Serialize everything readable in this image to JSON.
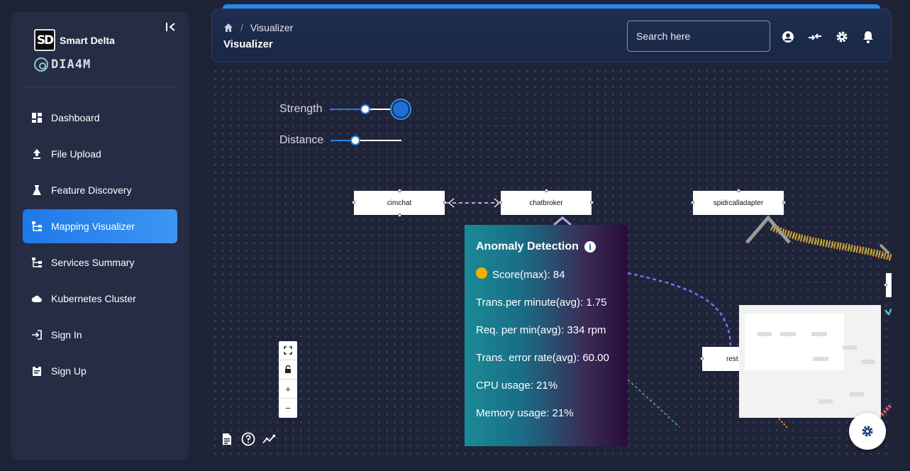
{
  "brand": {
    "logo_text": "SD",
    "name": "Smart Delta",
    "product": "DIA4M"
  },
  "sidebar": {
    "items": [
      {
        "label": "Dashboard",
        "icon": "dashboard-icon"
      },
      {
        "label": "File Upload",
        "icon": "upload-icon"
      },
      {
        "label": "Feature Discovery",
        "icon": "flask-icon"
      },
      {
        "label": "Mapping Visualizer",
        "icon": "tree-icon",
        "active": true
      },
      {
        "label": "Services Summary",
        "icon": "tree-icon"
      },
      {
        "label": "Kubernetes Cluster",
        "icon": "cloud-icon"
      },
      {
        "label": "Sign In",
        "icon": "login-icon"
      },
      {
        "label": "Sign Up",
        "icon": "assignment-icon"
      }
    ]
  },
  "header": {
    "breadcrumb": {
      "current": "Visualizer",
      "separator": "/"
    },
    "title": "Visualizer",
    "search_placeholder": "Search here"
  },
  "controls": {
    "strength_label": "Strength",
    "distance_label": "Distance",
    "strength_value": 0.5,
    "distance_value": 0.35
  },
  "graph": {
    "nodes": [
      "cimchat",
      "chatbroker",
      "spidrcalladapter",
      "rest"
    ]
  },
  "tooltip": {
    "title": "Anomaly Detection",
    "score": "Score(max): 84",
    "trans_per_minute": "Trans.per minute(avg): 1.75",
    "req_per_min": "Req. per min(avg): 334 rpm",
    "trans_error_rate": "Trans. error rate(avg): 60.00",
    "cpu_usage": "CPU usage: 21%",
    "memory_usage": "Memory usage: 21%",
    "score_color": "#f6b000"
  },
  "zoom": {
    "fit": "⛶",
    "lock": "🔒",
    "plus": "+",
    "minus": "−"
  },
  "colors": {
    "accent": "#2a7de1",
    "sidebar_bg": "#262c44",
    "canvas_bg": "#1f2438"
  }
}
